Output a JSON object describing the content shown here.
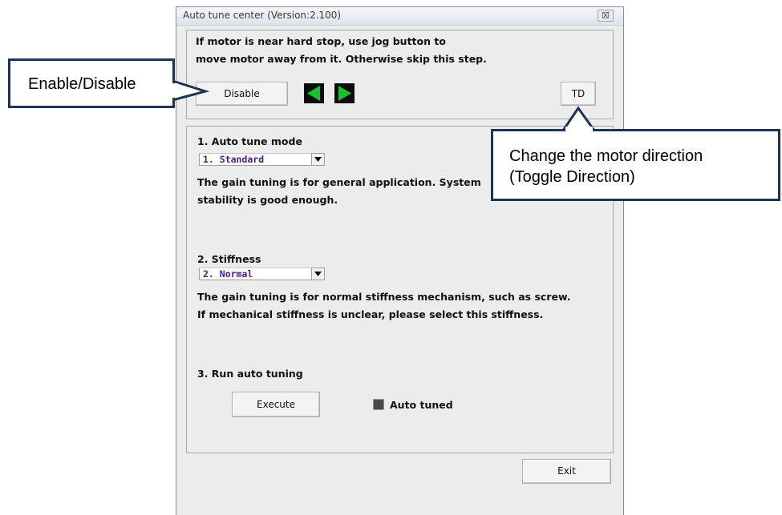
{
  "window": {
    "title": "Auto tune center (Version:2.100)",
    "close_glyph": "☒"
  },
  "jog": {
    "instruction_line1": "If motor is near hard stop, use jog button to",
    "instruction_line2": "move motor away from it. Otherwise skip this step.",
    "disable_label": "Disable",
    "td_label": "TD"
  },
  "mode": {
    "heading": "1. Auto tune mode",
    "selected": "1. Standard",
    "desc_line1": "The gain tuning is for general application. System",
    "desc_line2": "stability is good enough."
  },
  "stiffness": {
    "heading": "2. Stiffness",
    "selected": "2. Normal",
    "desc_line1": "The gain tuning is for normal stiffness mechanism, such as screw.",
    "desc_line2": "If mechanical stiffness is unclear, please select this stiffness."
  },
  "run": {
    "heading": "3. Run auto tuning",
    "execute_label": "Execute",
    "status_label": "Auto tuned"
  },
  "exit_label": "Exit",
  "callouts": {
    "enable_disable": "Enable/Disable",
    "td_line1": "Change the motor direction",
    "td_line2": "(Toggle Direction)"
  },
  "colors": {
    "jog_arrow": "#17c22e",
    "callout_border": "#1c3457",
    "combo_text": "#4a1a8c"
  }
}
